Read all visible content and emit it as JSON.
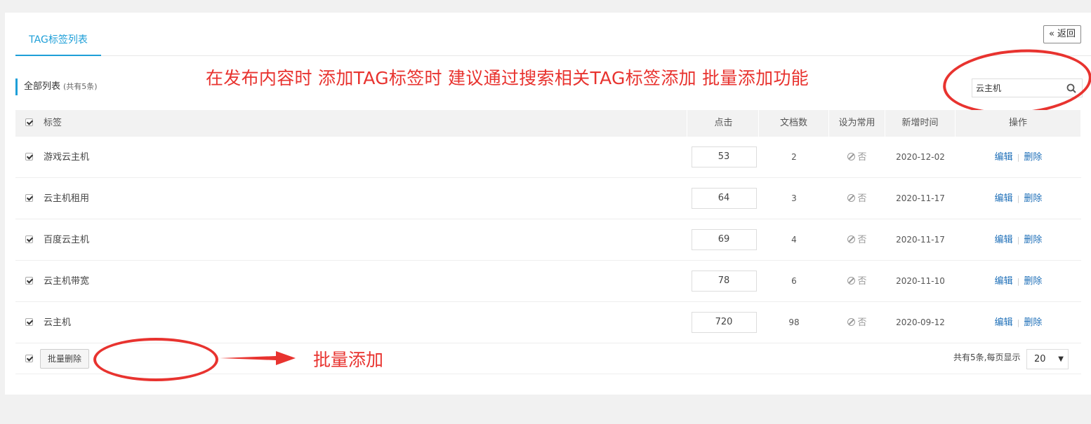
{
  "tabs": {
    "active": "TAG标签列表"
  },
  "header": {
    "back_label": "« 返回"
  },
  "list": {
    "title": "全部列表",
    "count_text": "(共有5条)"
  },
  "annotations": {
    "top": "在发布内容时 添加TAG标签时 建议通过搜索相关TAG标签添加 批量添加功能",
    "bottom": "批量添加"
  },
  "search": {
    "value": "云主机",
    "icon": "search-icon"
  },
  "table": {
    "headers": {
      "tag": "标签",
      "click": "点击",
      "docs": "文档数",
      "common": "设为常用",
      "date": "新增时间",
      "ops": "操作"
    },
    "rows": [
      {
        "tag": "游戏云主机",
        "click": "53",
        "docs": "2",
        "common": "否",
        "date": "2020-12-02",
        "edit": "编辑",
        "delete": "删除"
      },
      {
        "tag": "云主机租用",
        "click": "64",
        "docs": "3",
        "common": "否",
        "date": "2020-11-17",
        "edit": "编辑",
        "delete": "删除"
      },
      {
        "tag": "百度云主机",
        "click": "69",
        "docs": "4",
        "common": "否",
        "date": "2020-11-17",
        "edit": "编辑",
        "delete": "删除"
      },
      {
        "tag": "云主机带宽",
        "click": "78",
        "docs": "6",
        "common": "否",
        "date": "2020-11-10",
        "edit": "编辑",
        "delete": "删除"
      },
      {
        "tag": "云主机",
        "click": "720",
        "docs": "98",
        "common": "否",
        "date": "2020-09-12",
        "edit": "编辑",
        "delete": "删除"
      }
    ]
  },
  "footer": {
    "batch_delete": "批量删除",
    "pager_text": "共有5条,每页显示",
    "page_size": "20",
    "caret": "▼"
  },
  "colors": {
    "accent": "#1e9fd8",
    "annotation": "#e8332f",
    "link": "#1e6fb8"
  }
}
